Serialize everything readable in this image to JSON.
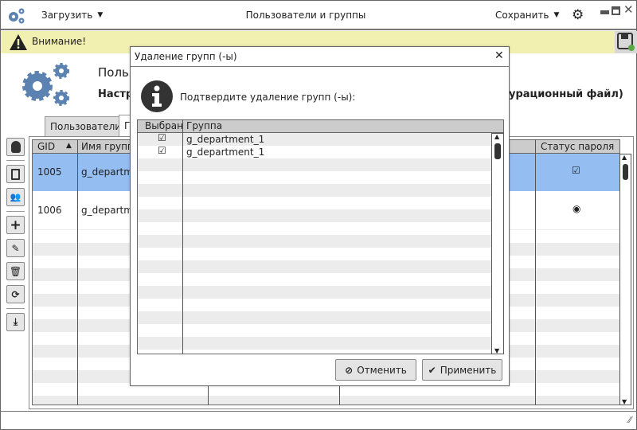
{
  "topbar": {
    "load_label": "Загрузить",
    "title": "Пользователи и группы",
    "save_label": "Сохранить"
  },
  "warning": {
    "text": "Внимание!"
  },
  "header": {
    "title_fragment": "Польз",
    "subtitle_fragment": "Настр",
    "subtitle_tail": "урационный файл)"
  },
  "tabs": [
    {
      "label": "Пользователи"
    },
    {
      "label": "Г"
    }
  ],
  "table": {
    "columns": [
      "GID",
      "Имя группы",
      "",
      "",
      "Статус пароля"
    ],
    "rows": [
      {
        "gid": "1005",
        "name": "g_departm",
        "status": "checkbox-checked",
        "selected": true
      },
      {
        "gid": "1006",
        "name": "g_departm",
        "status": "radio",
        "selected": false
      }
    ]
  },
  "dialog": {
    "title": "Удаление групп (-ы)",
    "message": "Подтвердите удаление групп (-ы):",
    "columns": [
      "Выбран",
      "Группа"
    ],
    "rows": [
      {
        "checked": true,
        "group": "g_department_1"
      },
      {
        "checked": true,
        "group": "g_department_1"
      }
    ],
    "cancel_label": "Отменить",
    "apply_label": "Применить"
  },
  "colors": {
    "accent": "#5b82b0",
    "selection": "#94bdf2",
    "warning": "#f2f0b0",
    "status_ok": "#5aa845"
  }
}
